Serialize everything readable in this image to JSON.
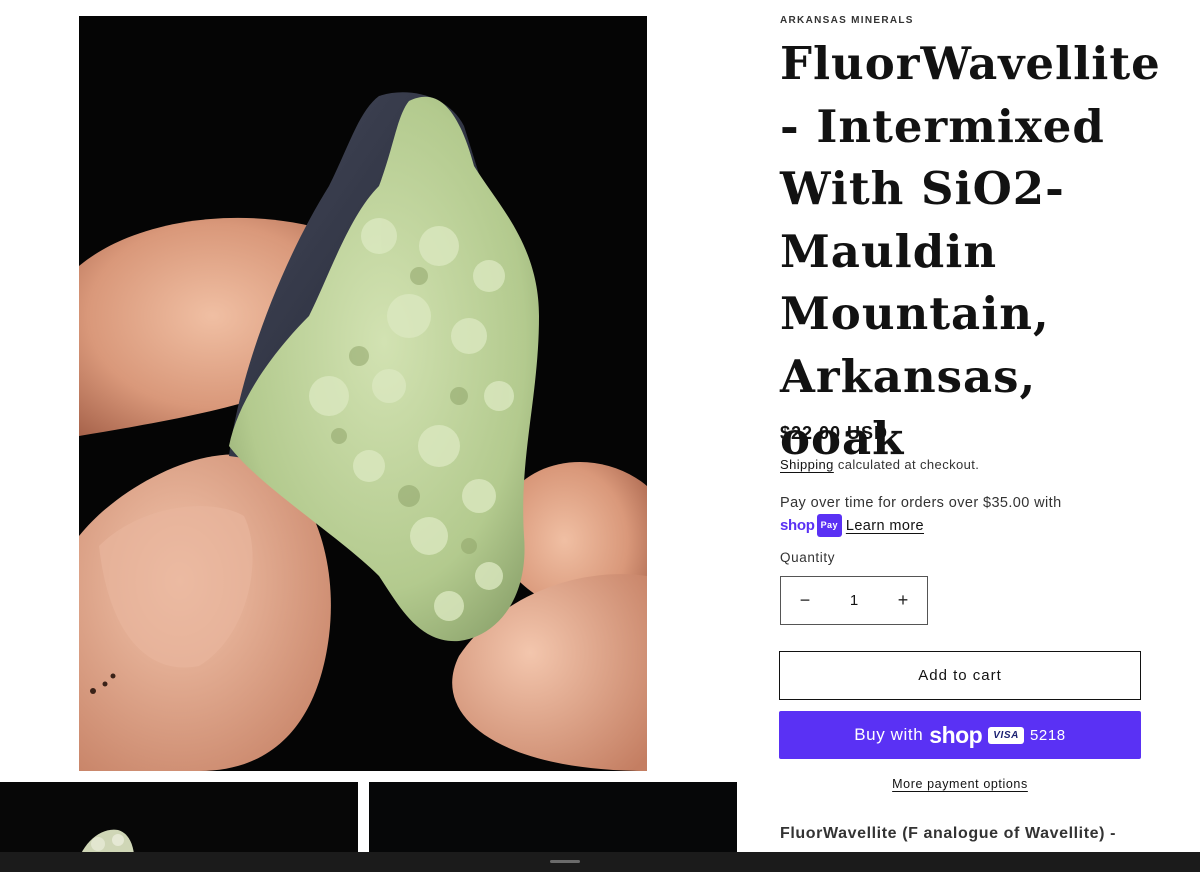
{
  "product": {
    "vendor": "ARKANSAS MINERALS",
    "title": "FluorWavellite - Intermixed With SiO2- Mauldin Mountain, Arkansas, ooak",
    "price": "$22.00 USD",
    "shipping_link": "Shipping",
    "shipping_rest": " calculated at checkout.",
    "installments_text": "Pay over time for orders over $35.00 with",
    "shop_logo": "shop",
    "shop_pay_badge": "Pay",
    "learn_more": "Learn more",
    "quantity_label": "Quantity",
    "quantity_value": "1",
    "minus_glyph": "−",
    "plus_glyph": "+",
    "add_to_cart": "Add to cart",
    "buy_with": "Buy with",
    "buy_shop_word": "shop",
    "card_brand": "VISA",
    "card_last4": "5218",
    "more_payment_options": "More payment options",
    "description_start": "FluorWavellite (F analogue of Wavellite) -"
  },
  "colors": {
    "shop_purple": "#5a31f4",
    "text": "#121212",
    "photo_background": "#050505",
    "specimen_green": "#b9cf98"
  },
  "gallery": {
    "main_image": "fluorwavellite-specimen-photo",
    "thumbnails": [
      "specimen-thumbnail-1",
      "specimen-thumbnail-2"
    ]
  }
}
